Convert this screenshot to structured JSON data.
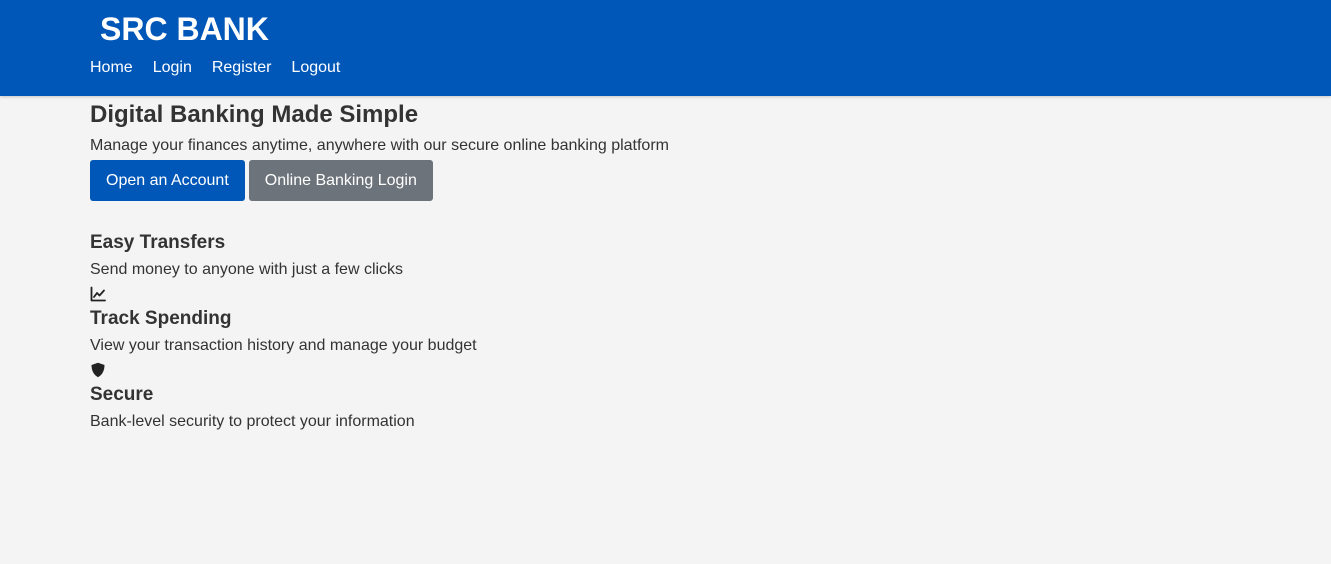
{
  "header": {
    "brand": "SRC BANK",
    "nav": [
      "Home",
      "Login",
      "Register",
      "Logout"
    ]
  },
  "hero": {
    "title": "Digital Banking Made Simple",
    "subtitle": "Manage your finances anytime, anywhere with our secure online banking platform",
    "primary_button": "Open an Account",
    "secondary_button": "Online Banking Login"
  },
  "features": [
    {
      "title": "Easy Transfers",
      "description": "Send money to anyone with just a few clicks",
      "icon": "none"
    },
    {
      "title": "Track Spending",
      "description": "View your transaction history and manage your budget",
      "icon": "chart-line-icon"
    },
    {
      "title": "Secure",
      "description": "Bank-level security to protect your information",
      "icon": "shield-icon"
    }
  ],
  "colors": {
    "header_bg": "#0057b8",
    "primary_button": "#0057b8",
    "secondary_button": "#6c737a",
    "page_bg": "#f4f4f4",
    "text": "#333333"
  }
}
